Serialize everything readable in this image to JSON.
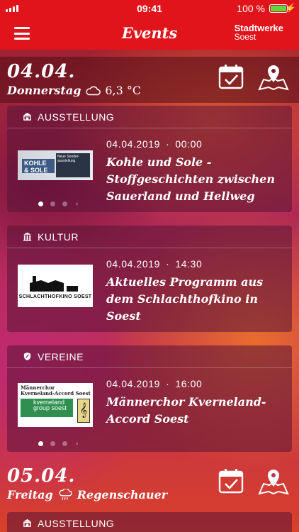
{
  "status_bar": {
    "time": "09:41",
    "battery": "100 %",
    "battery_fraction": 1.0
  },
  "nav": {
    "title": "Events",
    "brand_line1": "Stadtwerke",
    "brand_line2": "Soest"
  },
  "days": [
    {
      "date": "04.04.",
      "weekday": "Donnerstag",
      "weather": "6,3 °C",
      "weather_icon": "cloud-icon"
    },
    {
      "date": "05.04.",
      "weekday": "Freitag",
      "weather": "Regenschauer",
      "weather_icon": "rain-cloud-icon"
    }
  ],
  "events": [
    {
      "category": "AUSSTELLUNG",
      "category_icon": "museum-icon",
      "date": "04.04.2019",
      "time": "00:00",
      "title": "Kohle und Sole - Stoffgeschichten zwischen Sauerland und Hellweg",
      "thumb_text_1": "KOHLE & SOLE",
      "thumb_text_2": "Neue Sonder-ausstellung",
      "page_count": 3,
      "page_active": 1
    },
    {
      "category": "KULTUR",
      "category_icon": "theater-icon",
      "date": "04.04.2019",
      "time": "14:30",
      "title": "Aktuelles Programm aus dem Schlachthofkino in Soest",
      "thumb_text": "SCHLACHTHOFKINO SOEST"
    },
    {
      "category": "VEREINE",
      "category_icon": "shield-icon",
      "date": "04.04.2019",
      "time": "16:00",
      "title": "Männerchor Kverneland-Accord Soest",
      "thumb_text_1": "Männerchor",
      "thumb_text_2": "Kverneland-Accord Soest",
      "thumb_text_3": "kverneland group soest",
      "page_count": 3,
      "page_active": 1
    },
    {
      "category": "AUSSTELLUNG",
      "category_icon": "museum-icon"
    }
  ],
  "separator": "·"
}
